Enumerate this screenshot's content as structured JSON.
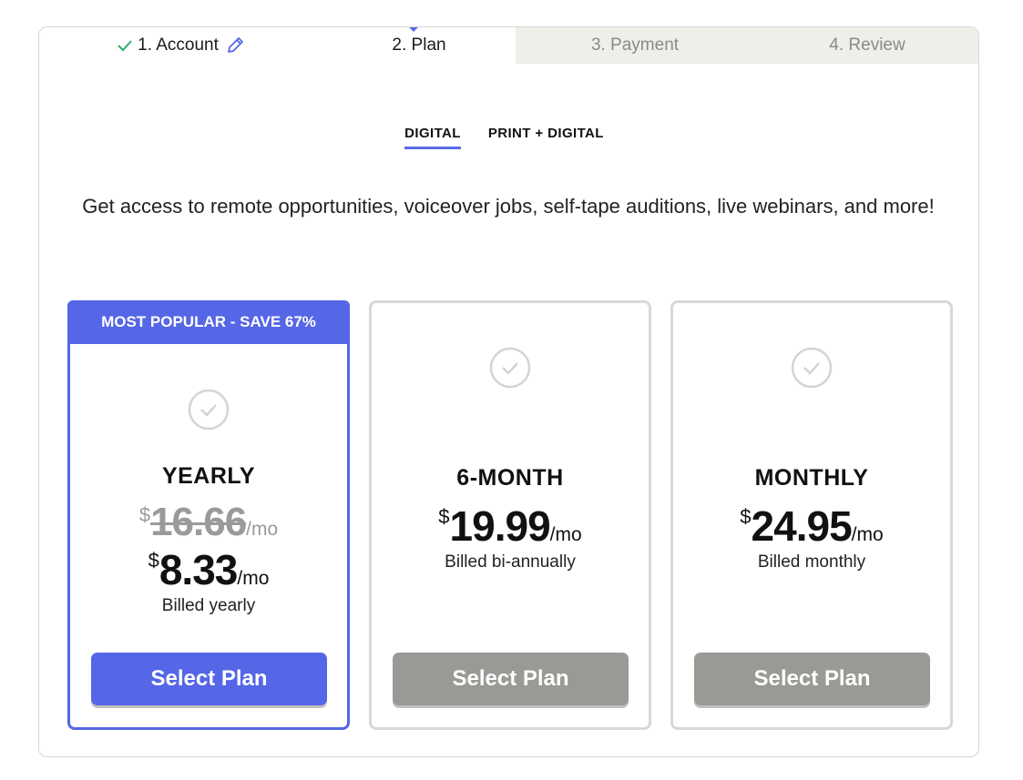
{
  "stepper": {
    "steps": [
      {
        "label": "1. Account",
        "state": "completed"
      },
      {
        "label": "2. Plan",
        "state": "current"
      },
      {
        "label": "3. Payment",
        "state": "upcoming"
      },
      {
        "label": "4. Review",
        "state": "upcoming"
      }
    ]
  },
  "tabs": [
    {
      "label": "DIGITAL",
      "active": true
    },
    {
      "label": "PRINT + DIGITAL",
      "active": false
    }
  ],
  "description": "Get access to remote opportunities, voiceover jobs, self-tape auditions, live webinars, and more!",
  "plans": [
    {
      "badge": "MOST POPULAR - SAVE 67%",
      "name": "YEARLY",
      "old_currency": "$",
      "old_price": "16.66",
      "old_per": "/mo",
      "currency": "$",
      "price": "8.33",
      "per": "/mo",
      "billed": "Billed yearly",
      "button": "Select Plan",
      "highlighted": true
    },
    {
      "name": "6-MONTH",
      "currency": "$",
      "price": "19.99",
      "per": "/mo",
      "billed": "Billed bi-annually",
      "button": "Select Plan",
      "highlighted": false
    },
    {
      "name": "MONTHLY",
      "currency": "$",
      "price": "24.95",
      "per": "/mo",
      "billed": "Billed monthly",
      "button": "Select Plan",
      "highlighted": false
    }
  ],
  "colors": {
    "accent": "#5566e6",
    "check": "#2fae6b",
    "button_disabled": "#9a9995",
    "step_inactive_bg": "#efeee9"
  },
  "icons": {
    "completed_step": "checkmark-icon",
    "edit_step": "pencil-icon",
    "plan_select": "check-circle-icon"
  }
}
